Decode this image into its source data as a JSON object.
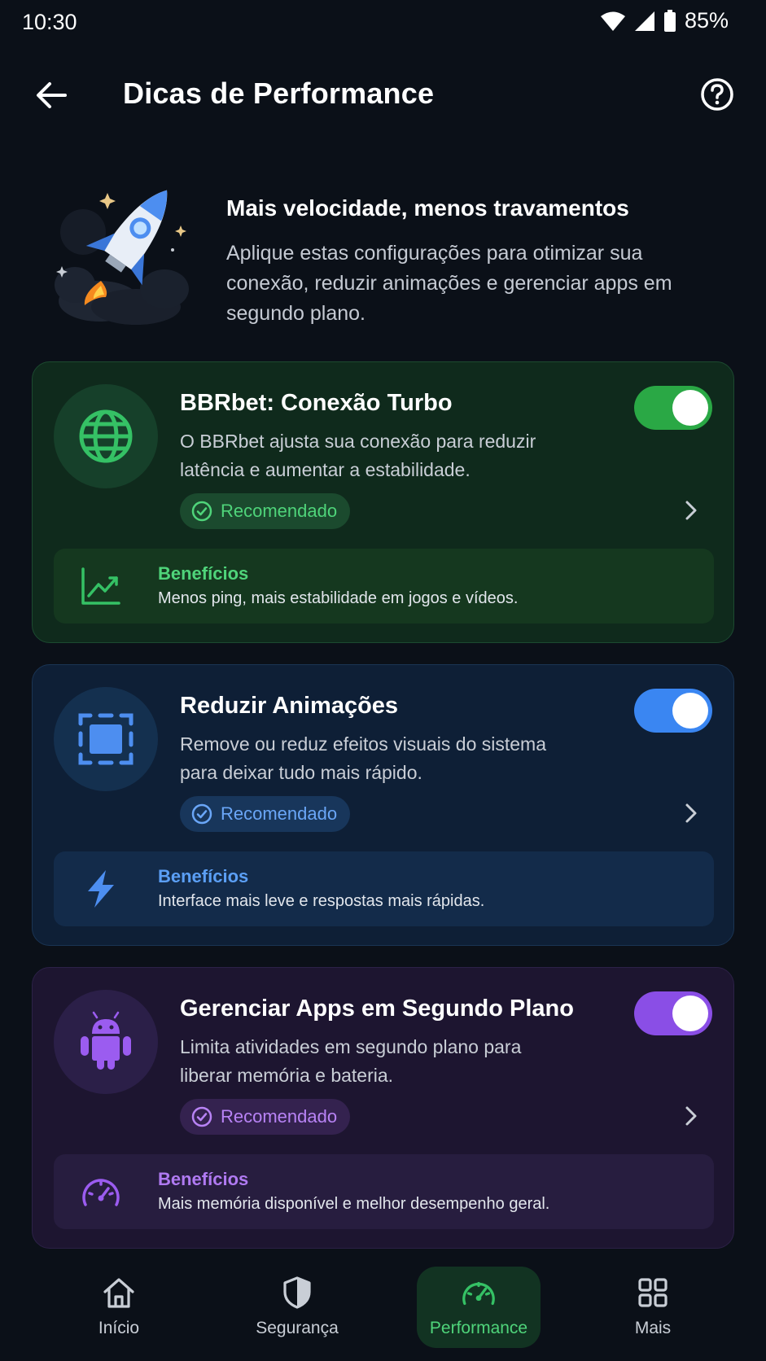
{
  "status_bar": {
    "time": "10:30",
    "battery": "85%"
  },
  "header": {
    "title": "Dicas de Performance"
  },
  "hero": {
    "title": "Mais velocidade, menos travamentos",
    "description": "Aplique estas configurações para otimizar sua conexão, reduzir animações e gerenciar apps em segundo plano."
  },
  "cards": [
    {
      "title": "BBRbet: Conexão Turbo",
      "description": "O BBRbet ajusta sua conexão para reduzir latência e aumentar a estabilidade.",
      "badge": "Recomendado",
      "toggle_on": true,
      "accent": "#2aa845",
      "benefit_title": "Benefícios",
      "benefit_text": "Menos ping, mais estabilidade em jogos e vídeos."
    },
    {
      "title": "Reduzir Animações",
      "description": "Remove ou reduz efeitos visuais do sistema para deixar tudo mais rápido.",
      "badge": "Recomendado",
      "toggle_on": true,
      "accent": "#3a86f2",
      "benefit_title": "Benefícios",
      "benefit_text": "Interface mais leve e respostas mais rápidas."
    },
    {
      "title": "Gerenciar Apps em Segundo Plano",
      "description": "Limita atividades em segundo plano para liberar memória e bateria.",
      "badge": "Recomendado",
      "toggle_on": true,
      "accent": "#8a4ee6",
      "benefit_title": "Benefícios",
      "benefit_text": "Mais memória disponível e melhor desempenho geral."
    }
  ],
  "bottom_nav": {
    "items": [
      {
        "label": "Início",
        "icon": "home-icon"
      },
      {
        "label": "Segurança",
        "icon": "shield-icon"
      },
      {
        "label": "Performance",
        "icon": "speedometer-icon",
        "active": true
      },
      {
        "label": "Mais",
        "icon": "grid-icon"
      }
    ]
  }
}
